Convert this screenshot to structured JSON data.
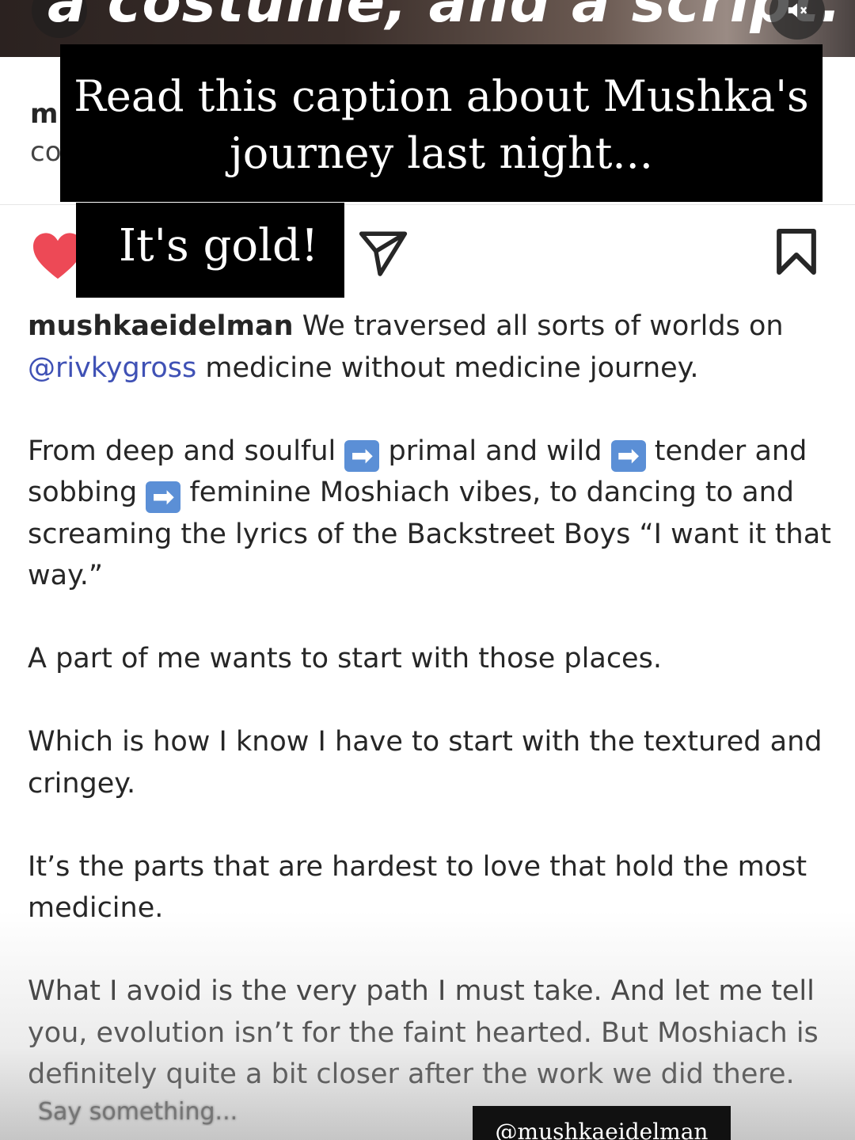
{
  "video": {
    "caption_fragment": "a costume, and a script."
  },
  "post_header": {
    "line1": "m",
    "line2": "co"
  },
  "overlays": {
    "big_line1": "Read this caption about Mushka's",
    "big_line2": "journey last night...",
    "small": "It's gold!"
  },
  "caption": {
    "username": "mushkaeidelman",
    "p1_text": " We traversed all sorts of worlds on ",
    "mention": "@rivkygross",
    "p1_rest": " medicine without medicine journey.",
    "p2_a": "From deep and soulful ",
    "p2_b": " primal and wild ",
    "p2_c": " tender and sobbing ",
    "p2_d": " feminine Moshiach vibes, to dancing to and screaming the lyrics of the Backstreet Boys “I want it that way.”",
    "arrow_glyph": "➡",
    "p3": "A part of me wants to start with those places.",
    "p4": "Which is how I know I have to start with the textured and cringey.",
    "p5": "It’s the parts that are hardest to love that hold the most medicine.",
    "p6": "What I avoid is the very path I must take. And let me tell you, evolution isn’t for the faint hearted. But Moshiach is definitely quite a bit closer after the work we did there."
  },
  "story_ui": {
    "reply_placeholder": "Say something...",
    "handle_tag": "@mushkaeidelman"
  },
  "colors": {
    "heart": "#ed4956",
    "mention": "#3f51b5",
    "arrow_emoji_bg": "#5b8fd6"
  },
  "icons": {
    "like": "heart-icon",
    "share": "send-icon",
    "save": "bookmark-icon",
    "mute": "speaker-muted-icon"
  }
}
